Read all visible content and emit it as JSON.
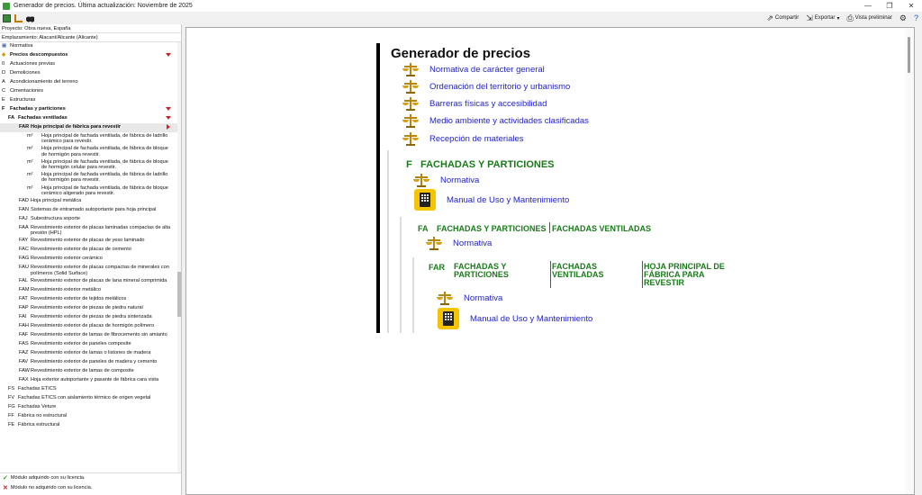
{
  "window": {
    "title": "Generador de precios. Última actualización: Noviembre de 2025",
    "controls": [
      "—",
      "❐",
      "✕"
    ]
  },
  "toolbar": {
    "share_label": "Compartir",
    "export_label": "Exportar",
    "preview_label": "Vista preliminar"
  },
  "project": {
    "proyecto": "Proyecto: Obra nueva, España",
    "emplazamiento": "Emplazamiento: Alacant/Alicante (Alicante)"
  },
  "tree": {
    "normativa": "Normativa",
    "rows": [
      {
        "code": "",
        "label": "Precios descompuestos",
        "bold": true
      },
      {
        "code": "0",
        "label": "Actuaciones previas"
      },
      {
        "code": "D",
        "label": "Demoliciones"
      },
      {
        "code": "A",
        "label": "Acondicionamiento del terreno"
      },
      {
        "code": "C",
        "label": "Cimentaciones"
      },
      {
        "code": "E",
        "label": "Estructuras"
      },
      {
        "code": "F",
        "label": "Fachadas y particiones",
        "bold": true
      },
      {
        "code": "FA",
        "label": "Fachadas ventiladas",
        "bold": true
      },
      {
        "code": "FAR",
        "label": "Hoja principal de fábrica para revestir",
        "bold": true
      },
      {
        "code": "m²",
        "label": "Hoja principal de fachada ventilada, de fábrica de ladrillo cerámico para revestir."
      },
      {
        "code": "m²",
        "label": "Hoja principal de fachada ventilada, de fábrica de bloque de hormigón para revestir."
      },
      {
        "code": "m²",
        "label": "Hoja principal de fachada ventilada, de fábrica de bloque de hormigón celular para revestir."
      },
      {
        "code": "m²",
        "label": "Hoja principal de fachada ventilada, de fábrica de ladrillo de hormigón para revestir."
      },
      {
        "code": "m²",
        "label": "Hoja principal de fachada ventilada, de fábrica de bloque cerámico aligerado para revestir."
      },
      {
        "code": "FAD",
        "label": "Hoja principal metálica"
      },
      {
        "code": "FAN",
        "label": "Sistemas de entramado autoportante para hoja principal"
      },
      {
        "code": "FAJ",
        "label": "Subestructura soporte"
      },
      {
        "code": "FAA",
        "label": "Revestimiento exterior de placas laminadas compactas de alta presión (HPL)"
      },
      {
        "code": "FAY",
        "label": "Revestimiento exterior de placas de yeso laminado"
      },
      {
        "code": "FAC",
        "label": "Revestimiento exterior de placas de cemento"
      },
      {
        "code": "FAG",
        "label": "Revestimiento exterior cerámico"
      },
      {
        "code": "FAU",
        "label": "Revestimiento exterior de placas compactas de minerales con polímeros (Solid Surface)"
      },
      {
        "code": "FAL",
        "label": "Revestimiento exterior de placas de lana mineral comprimida"
      },
      {
        "code": "FAM",
        "label": "Revestimiento exterior metálico"
      },
      {
        "code": "FAT",
        "label": "Revestimiento exterior de tejidos metálicos"
      },
      {
        "code": "FAP",
        "label": "Revestimiento exterior de piezas de piedra natural"
      },
      {
        "code": "FAI",
        "label": "Revestimiento exterior de piezas de piedra sinterizada"
      },
      {
        "code": "FAH",
        "label": "Revestimiento exterior de placas de hormigón polímero"
      },
      {
        "code": "FAF",
        "label": "Revestimiento exterior de lamas de fibrocemento sin amianto"
      },
      {
        "code": "FAS",
        "label": "Revestimiento exterior de paneles composite"
      },
      {
        "code": "FAZ",
        "label": "Revestimiento exterior de lamas o listones de madera"
      },
      {
        "code": "FAV",
        "label": "Revestimiento exterior de paneles de madera y cemento"
      },
      {
        "code": "FAW",
        "label": "Revestimiento exterior de lamas de composite"
      },
      {
        "code": "FAX",
        "label": "Hoja exterior autoportante y pasante de fábrica cara vista"
      },
      {
        "code": "FS",
        "label": "Fachadas ETICS"
      },
      {
        "code": "FV",
        "label": "Fachadas ETICS con aislamiento térmico de origen vegetal"
      },
      {
        "code": "FG",
        "label": "Fachadas Veture"
      },
      {
        "code": "FF",
        "label": "Fábrica no estructural"
      },
      {
        "code": "FE",
        "label": "Fábrica estructural"
      }
    ]
  },
  "legend": {
    "ok": "Módulo adquirido con su licencia.",
    "no": "Módulo no adquirido con su licencia."
  },
  "doc": {
    "title": "Generador de precios",
    "top_links": [
      "Normativa de carácter general",
      "Ordenación del territorio y urbanismo",
      "Barreras físicas y accesibilidad",
      "Medio ambiente y actividades clasificadas",
      "Recepción de materiales"
    ],
    "f_code": "F",
    "f_title": "FACHADAS Y PARTICIONES",
    "normativa": "Normativa",
    "manual": "Manual de Uso y Mantenimiento",
    "fa_code": "FA",
    "fa_part1": "FACHADAS Y PARTICIONES",
    "fa_part2": "FACHADAS VENTILADAS",
    "far_code": "FAR",
    "far_part1": "FACHADAS Y PARTICIONES",
    "far_part2": "FACHADAS VENTILADAS",
    "far_part3": "HOJA PRINCIPAL DE FÁBRICA PARA REVESTIR"
  },
  "colors": {
    "link": "#2323c8",
    "section": "#1a7a1a",
    "accent_red": "#d02020",
    "manual_yellow": "#f5c400"
  }
}
